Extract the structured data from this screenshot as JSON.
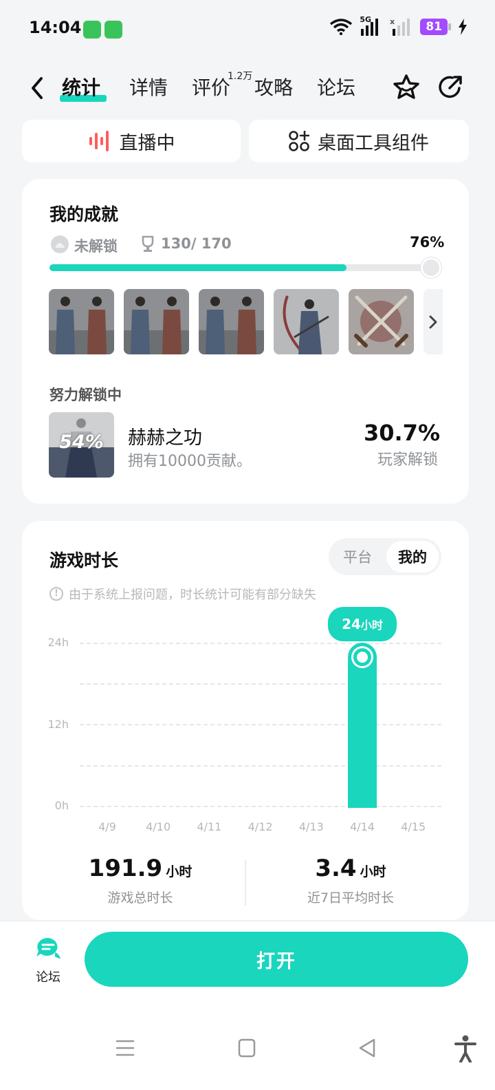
{
  "status": {
    "time": "14:04",
    "network": "5G",
    "battery": "81"
  },
  "header": {
    "tabs": [
      {
        "label": "统计"
      },
      {
        "label": "详情"
      },
      {
        "label": "评价"
      },
      {
        "label": "攻略"
      },
      {
        "label": "论坛"
      }
    ],
    "rating_count": "1.2万"
  },
  "pills": {
    "live": "直播中",
    "widget": "桌面工具组件"
  },
  "achievements": {
    "title": "我的成就",
    "locked_label": "未解锁",
    "count": "130/ 170",
    "percent": "76%",
    "progress": 0.76,
    "in_progress_title": "努力解锁中",
    "current": {
      "badge": "54%",
      "name": "赫赫之功",
      "desc": "拥有10000贡献。",
      "rate": "30.7%",
      "rate_label": "玩家解锁"
    }
  },
  "playtime": {
    "title": "游戏时长",
    "toggle": [
      "平台",
      "我的"
    ],
    "note": "由于系统上报问题，时长统计可能有部分缺失",
    "total_value": "191.9",
    "total_unit": "小时",
    "total_label": "游戏总时长",
    "avg_value": "3.4",
    "avg_unit": "小时",
    "avg_label": "近7日平均时长"
  },
  "chart_data": {
    "type": "bar",
    "categories": [
      "4/9",
      "4/10",
      "4/11",
      "4/12",
      "4/13",
      "4/14",
      "4/15"
    ],
    "values": [
      0,
      0,
      0,
      0,
      0,
      24,
      0
    ],
    "ylim": [
      0,
      24
    ],
    "yticks": [
      "24h",
      "12h",
      "0h"
    ],
    "highlight_label_value": "24",
    "highlight_label_unit": "小时",
    "grid": true
  },
  "bottom": {
    "forum_label": "论坛",
    "open_label": "打开"
  },
  "colors": {
    "accent": "#19d6bd",
    "live_red": "#ff5b5b",
    "battery": "#a24bff"
  }
}
